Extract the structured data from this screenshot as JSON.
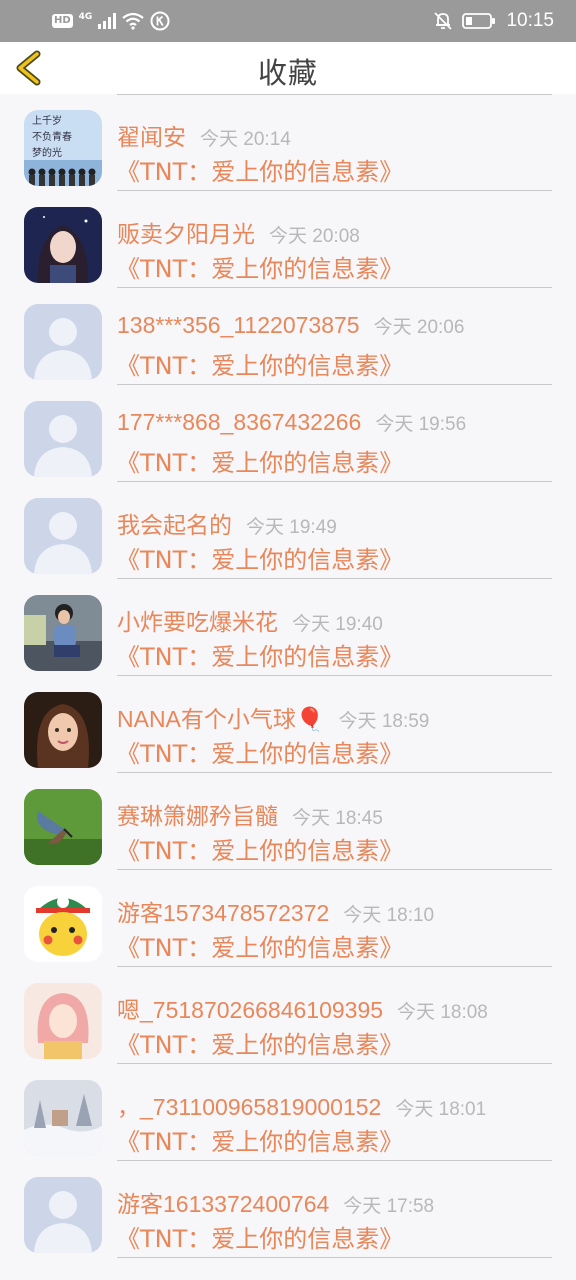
{
  "status_bar": {
    "hd": "HD",
    "network": "4G",
    "time": "10:15"
  },
  "header": {
    "title": "收藏"
  },
  "colors": {
    "accent": "#e8875a",
    "time": "#b8b8b8",
    "status_bar": "#9a9a9a"
  },
  "items": [
    {
      "name": "翟闻安",
      "time": "今天 20:14",
      "work": "《TNT：爱上你的信息素》",
      "avatar": "group-photo"
    },
    {
      "name": "贩卖夕阳月光",
      "time": "今天 20:08",
      "work": "《TNT：爱上你的信息素》",
      "avatar": "anime-girl"
    },
    {
      "name": "138***356_1122073875",
      "time": "今天 20:06",
      "work": "《TNT：爱上你的信息素》",
      "avatar": "default"
    },
    {
      "name": "177***868_8367432266",
      "time": "今天 19:56",
      "work": "《TNT：爱上你的信息素》",
      "avatar": "default"
    },
    {
      "name": "我会起名的",
      "time": "今天 19:49",
      "work": "《TNT：爱上你的信息素》",
      "avatar": "default"
    },
    {
      "name": "小炸要吃爆米花",
      "time": "今天 19:40",
      "work": "《TNT：爱上你的信息素》",
      "avatar": "person-photo"
    },
    {
      "name": "NANA有个小气球🎈",
      "time": "今天 18:59",
      "work": "《TNT：爱上你的信息素》",
      "avatar": "girl-photo"
    },
    {
      "name": "赛琳箫娜矜旨髓",
      "time": "今天 18:45",
      "work": "《TNT：爱上你的信息素》",
      "avatar": "butterfly"
    },
    {
      "name": "游客1573478572372",
      "time": "今天 18:10",
      "work": "《TNT：爱上你的信息素》",
      "avatar": "pikachu"
    },
    {
      "name": "嗯_751870266846109395",
      "time": "今天 18:08",
      "work": "《TNT：爱上你的信息素》",
      "avatar": "pink-girl"
    },
    {
      "name": "，_731100965819000152",
      "time": "今天 18:01",
      "work": "《TNT：爱上你的信息素》",
      "avatar": "snow-scene"
    },
    {
      "name": "游客1613372400764",
      "time": "今天 17:58",
      "work": "《TNT：爱上你的信息素》",
      "avatar": "default"
    }
  ]
}
